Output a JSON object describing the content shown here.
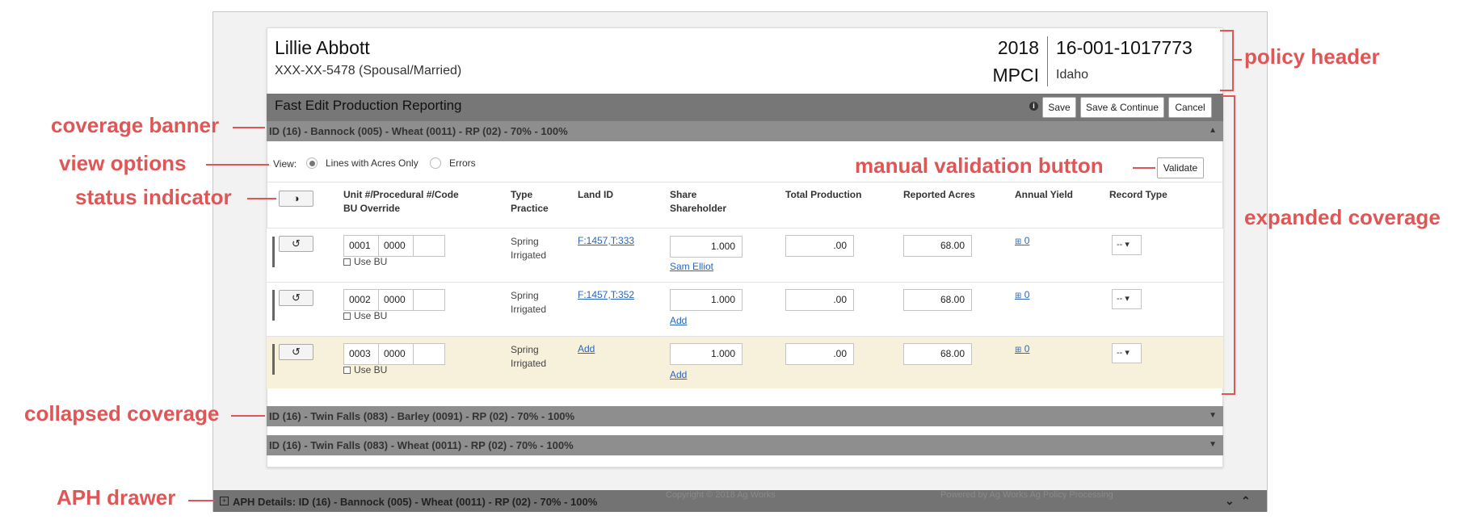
{
  "policy_header": {
    "name": "Lillie Abbott",
    "ssn_status": "XXX-XX-5478 (Spousal/Married)",
    "year": "2018",
    "insurance_type": "MPCI",
    "policy_number": "16-001-1017773",
    "state": "Idaho"
  },
  "toolbar": {
    "title": "Fast Edit Production Reporting",
    "info_icon": "info-icon",
    "save_label": "Save",
    "save_continue_label": "Save & Continue",
    "cancel_label": "Cancel"
  },
  "coverages": [
    {
      "label": "ID (16) - Bannock (005) - Wheat (0011) - RP (02) - 70% - 100%",
      "state": "expanded",
      "caret": "▲"
    },
    {
      "label": "ID (16) - Twin Falls (083) - Barley (0091) - RP (02) - 70% - 100%",
      "state": "collapsed",
      "caret": "▼"
    },
    {
      "label": "ID (16) - Twin Falls (083) - Wheat (0011) - RP (02) - 70% - 100%",
      "state": "collapsed",
      "caret": "▼"
    }
  ],
  "view_options": {
    "label": "View:",
    "options": [
      {
        "label": "Lines with Acres Only",
        "selected": true
      },
      {
        "label": "Errors",
        "selected": false
      }
    ],
    "validate_label": "Validate"
  },
  "table": {
    "status_button_icon": "◑",
    "headers": {
      "unit_line1": "Unit #/Procedural #/Code",
      "unit_line2": "BU Override",
      "type_line1": "Type",
      "type_line2": "Practice",
      "land_id": "Land ID",
      "share_line1": "Share",
      "share_line2": "Shareholder",
      "total_production": "Total Production",
      "reported_acres": "Reported Acres",
      "annual_yield": "Annual Yield",
      "record_type": "Record Type"
    },
    "rows": [
      {
        "reset_icon": "↺",
        "unit": "0001",
        "procedural": "0000",
        "code": "",
        "use_bu": "Use BU",
        "type": "Spring",
        "practice": "Irrigated",
        "land_id": "F:1457,T:333",
        "share": "1.000",
        "shareholder": "Sam Elliot",
        "total_production": ".00",
        "reported_acres": "68.00",
        "annual_yield": "0",
        "record_type": "--",
        "highlighted": false
      },
      {
        "reset_icon": "↺",
        "unit": "0002",
        "procedural": "0000",
        "code": "",
        "use_bu": "Use BU",
        "type": "Spring",
        "practice": "Irrigated",
        "land_id": "F:1457,T:352",
        "share": "1.000",
        "shareholder": "Add",
        "total_production": ".00",
        "reported_acres": "68.00",
        "annual_yield": "0",
        "record_type": "--",
        "highlighted": false
      },
      {
        "reset_icon": "↺",
        "unit": "0003",
        "procedural": "0000",
        "code": "",
        "use_bu": "Use BU",
        "type": "Spring",
        "practice": "Irrigated",
        "land_id": "Add",
        "share": "1.000",
        "shareholder": "Add",
        "total_production": ".00",
        "reported_acres": "68.00",
        "annual_yield": "0",
        "record_type": "--",
        "highlighted": true
      }
    ]
  },
  "aph_drawer": {
    "label": "APH Details: ID (16) - Bannock (005) - Wheat (0011) - RP (02) - 70% - 100%",
    "ghost_footer": [
      "Copyright © 2018 Ag Works",
      "Powered by Ag Works Ag Policy Processing"
    ]
  },
  "annotations": {
    "policy_header": "policy header",
    "coverage_banner": "coverage banner",
    "view_options": "view options",
    "status_indicator": "status indicator",
    "manual_validation": "manual validation button",
    "expanded_coverage": "expanded coverage",
    "collapsed_coverage": "collapsed coverage",
    "aph_drawer": "APH drawer"
  },
  "colors": {
    "annotation": "#e05656",
    "banner": "#8e8e8e",
    "titlebar": "#777777",
    "highlight_row": "#f7f1dc",
    "link": "#2a66b8"
  }
}
